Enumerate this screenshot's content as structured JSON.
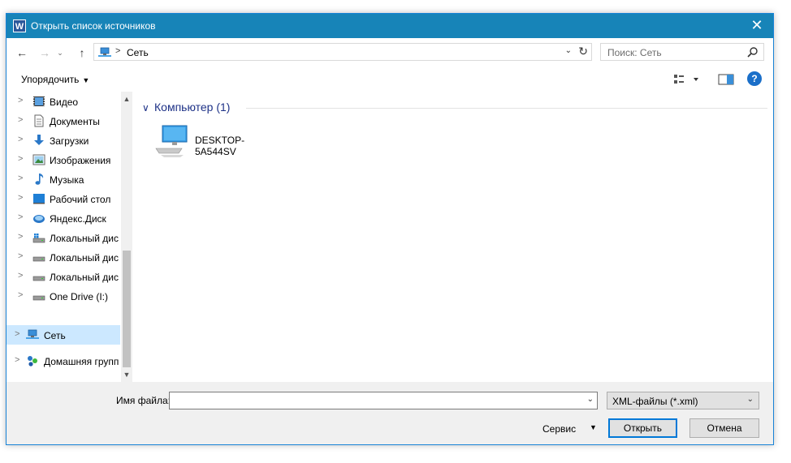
{
  "window": {
    "title": "Открыть список источников",
    "app_icon_letter": "W",
    "close_glyph": "✕"
  },
  "nav": {
    "back_glyph": "←",
    "forward_glyph": "→",
    "recent_glyph": "⌄",
    "up_glyph": "↑"
  },
  "address": {
    "separator": ">",
    "path": "Сеть",
    "dropdown_glyph": "⌄",
    "refresh_glyph": "↻"
  },
  "search": {
    "placeholder": "Поиск: Сеть"
  },
  "toolbar": {
    "organize_label": "Упорядочить",
    "organize_caret": "▼",
    "help_glyph": "?"
  },
  "sidebar": {
    "items": [
      {
        "label": "Видео",
        "icon": "video-icon"
      },
      {
        "label": "Документы",
        "icon": "documents-icon"
      },
      {
        "label": "Загрузки",
        "icon": "downloads-icon"
      },
      {
        "label": "Изображения",
        "icon": "pictures-icon"
      },
      {
        "label": "Музыка",
        "icon": "music-icon"
      },
      {
        "label": "Рабочий стол",
        "icon": "desktop-icon"
      },
      {
        "label": "Яндекс.Диск",
        "icon": "yandex-disk-icon"
      },
      {
        "label": "Локальный дис",
        "icon": "drive-os-icon"
      },
      {
        "label": "Локальный дис",
        "icon": "drive-icon"
      },
      {
        "label": "Локальный дис",
        "icon": "drive-icon"
      },
      {
        "label": "One Drive (I:)",
        "icon": "drive-icon"
      },
      {
        "label": "Сеть",
        "icon": "network-icon"
      },
      {
        "label": "Домашняя групп",
        "icon": "homegroup-icon"
      }
    ],
    "chevron_glyph": ">",
    "scroll_up_glyph": "▲",
    "scroll_down_glyph": "▼"
  },
  "content": {
    "group_chevron": "∨",
    "group_title": "Компьютер (1)",
    "items": [
      {
        "label": "DESKTOP-5A544SV",
        "icon": "computer-icon"
      }
    ]
  },
  "bottom": {
    "filename_label": "Имя файла:",
    "filename_value": "",
    "filename_dropdown_glyph": "⌄",
    "filter_value": "XML-файлы (*.xml)",
    "filter_dropdown_glyph": "⌄",
    "tools_label": "Сервис",
    "tools_caret": "▼",
    "open_label": "Открыть",
    "cancel_label": "Отмена"
  },
  "colors": {
    "titlebar": "#1784b8",
    "selection": "#cce8ff",
    "group_title": "#1e3287",
    "default_button_border": "#0078d7"
  }
}
